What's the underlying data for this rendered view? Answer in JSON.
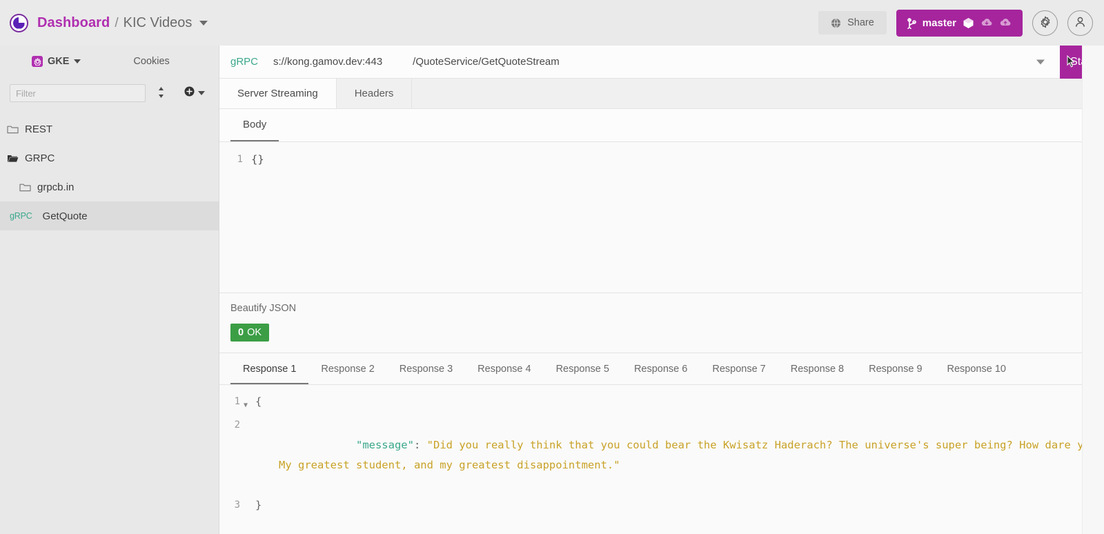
{
  "header": {
    "logo_icon": "hoppscotch-logo-icon",
    "breadcrumb": {
      "workspace": "Dashboard",
      "separator": "/",
      "collection": "KIC Videos"
    },
    "share_label": "Share",
    "share_icon": "globe-icon",
    "branch_label": "master",
    "branch_icon": "git-branch-icon",
    "cube_icon": "cube-icon",
    "cloud_download_icon": "cloud-download-icon",
    "cloud_upload_icon": "cloud-upload-icon",
    "settings_icon": "gear-icon",
    "account_icon": "user-avatar-icon"
  },
  "sidebar": {
    "environment": {
      "icon": "gke-icon",
      "label": "GKE"
    },
    "cookies_label": "Cookies",
    "filter_placeholder": "Filter",
    "filter_value": "",
    "sort_icon": "sort-updown-icon",
    "add_icon": "add-circle-icon",
    "tree": [
      {
        "label": "REST",
        "icon": "folder-closed-icon",
        "level": 1,
        "selected": false,
        "tag": ""
      },
      {
        "label": "GRPC",
        "icon": "folder-open-icon",
        "level": 1,
        "selected": false,
        "tag": ""
      },
      {
        "label": "grpcb.in",
        "icon": "folder-closed-icon",
        "level": 2,
        "selected": false,
        "tag": ""
      },
      {
        "label": "GetQuote",
        "icon": "",
        "level": 3,
        "selected": true,
        "tag": "gRPC"
      }
    ]
  },
  "request": {
    "protocol": "gRPC",
    "url": "s://kong.gamov.dev:443",
    "method_path": "/QuoteService/GetQuoteStream",
    "start_label": "Start",
    "dropdown_icon": "chevron-down-icon",
    "tabs": [
      {
        "label": "Server Streaming",
        "active": true
      },
      {
        "label": "Headers",
        "active": false
      }
    ],
    "body_tabs": [
      {
        "label": "Body",
        "active": true
      }
    ],
    "body_lines": [
      {
        "num": "1",
        "text": "{}",
        "fold": false
      }
    ]
  },
  "response": {
    "beautify_label": "Beautify JSON",
    "status_code": "0",
    "status_text": "OK",
    "status_color": "#3b9e45",
    "tabs": [
      {
        "label": "Response 1",
        "active": true
      },
      {
        "label": "Response 2",
        "active": false
      },
      {
        "label": "Response 3",
        "active": false
      },
      {
        "label": "Response 4",
        "active": false
      },
      {
        "label": "Response 5",
        "active": false
      },
      {
        "label": "Response 6",
        "active": false
      },
      {
        "label": "Response 7",
        "active": false
      },
      {
        "label": "Response 8",
        "active": false
      },
      {
        "label": "Response 9",
        "active": false
      },
      {
        "label": "Response 10",
        "active": false
      }
    ],
    "body": {
      "line1_num": "1",
      "line1_text": "{",
      "line2_num": "2",
      "line2_key": "\"message\"",
      "line2_colon": ": ",
      "line2_value": "\"Did you really think that you could bear the Kwisatz Haderach? The universe's super being? How dare you. My greatest student, and my greatest disappointment.\"",
      "line3_num": "3",
      "line3_text": "}"
    }
  },
  "colors": {
    "accent": "#a6259d",
    "brand_purple": "#5b21b6",
    "grpc_teal": "#3aa88b",
    "status_green": "#3b9e45",
    "json_key": "#3aa88b",
    "json_string": "#c9a227"
  }
}
